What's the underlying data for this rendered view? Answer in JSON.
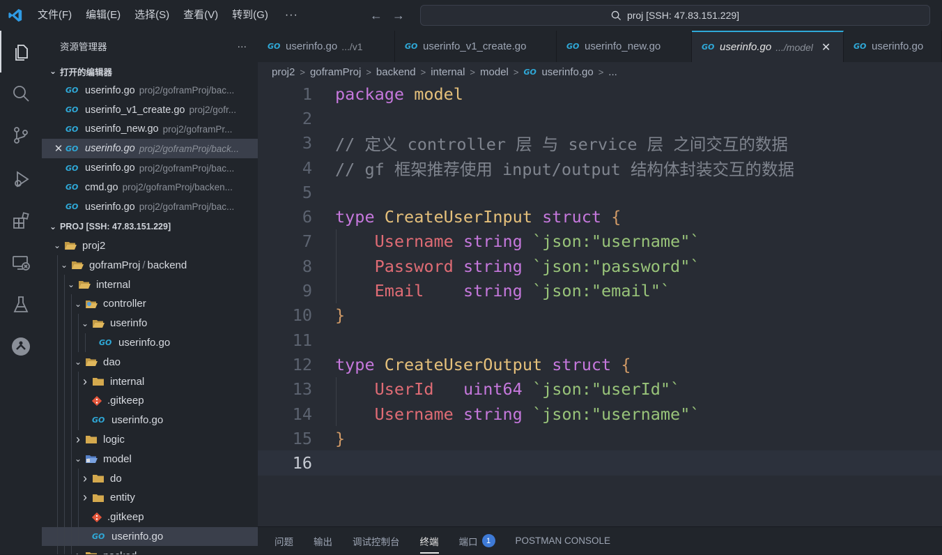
{
  "menu": [
    "文件(F)",
    "编辑(E)",
    "选择(S)",
    "查看(V)",
    "转到(G)"
  ],
  "menu_more": "···",
  "search": {
    "text": "proj [SSH: 47.83.151.229]"
  },
  "explorer": {
    "title": "资源管理器",
    "more": "···",
    "open_editors_title": "打开的编辑器",
    "open_editors": [
      {
        "name": "userinfo.go",
        "path": "proj2/goframProj/bac..."
      },
      {
        "name": "userinfo_v1_create.go",
        "path": "proj2/gofr..."
      },
      {
        "name": "userinfo_new.go",
        "path": "proj2/goframPr..."
      },
      {
        "name": "userinfo.go",
        "path": "proj2/goframProj/back..."
      },
      {
        "name": "userinfo.go",
        "path": "proj2/goframProj/bac..."
      },
      {
        "name": "cmd.go",
        "path": "proj2/goframProj/backen..."
      },
      {
        "name": "userinfo.go",
        "path": "proj2/goframProj/bac..."
      }
    ],
    "workspace_title": "PROJ [SSH: 47.83.151.229]",
    "tree": [
      {
        "label": "proj2"
      },
      {
        "label": "goframProj",
        "label2": "backend",
        "sep": "/"
      },
      {
        "label": "internal"
      },
      {
        "label": "controller"
      },
      {
        "label": "userinfo"
      },
      {
        "label": "userinfo.go"
      },
      {
        "label": "dao"
      },
      {
        "label": "internal"
      },
      {
        "label": ".gitkeep"
      },
      {
        "label": "userinfo.go"
      },
      {
        "label": "logic"
      },
      {
        "label": "model"
      },
      {
        "label": "do"
      },
      {
        "label": "entity"
      },
      {
        "label": ".gitkeep"
      },
      {
        "label": "userinfo.go"
      },
      {
        "label": "packed"
      }
    ]
  },
  "tabs": [
    {
      "name": "userinfo.go",
      "sub": ".../v1"
    },
    {
      "name": "userinfo_v1_create.go",
      "sub": ""
    },
    {
      "name": "userinfo_new.go",
      "sub": ""
    },
    {
      "name": "userinfo.go",
      "sub": ".../model"
    },
    {
      "name": "userinfo.go",
      "sub": ""
    }
  ],
  "tab_close": "✕",
  "go_icon": "GO",
  "breadcrumb": [
    "proj2",
    "goframProj",
    "backend",
    "internal",
    "model",
    "userinfo.go",
    "..."
  ],
  "code": {
    "line_numbers": [
      "1",
      "2",
      "3",
      "4",
      "5",
      "6",
      "7",
      "8",
      "9",
      "10",
      "11",
      "12",
      "13",
      "14",
      "15",
      "16"
    ],
    "l1": [
      "package",
      "model"
    ],
    "l3": "// 定义 controller 层 与 service 层 之间交互的数据",
    "l4": "// gf 框架推荐使用 input/output 结构体封装交互的数据",
    "l6": [
      "type",
      "CreateUserInput",
      "struct",
      "{"
    ],
    "l7": [
      "Username",
      "string",
      "`json:\"username\"`"
    ],
    "l8": [
      "Password",
      "string",
      "`json:\"password\"`"
    ],
    "l9": [
      "Email",
      "string",
      "`json:\"email\"`"
    ],
    "l10": "}",
    "l12": [
      "type",
      "CreateUserOutput",
      "struct",
      "{"
    ],
    "l13": [
      "UserId",
      "uint64",
      "`json:\"userId\"`"
    ],
    "l14": [
      "Username",
      "string",
      "`json:\"username\"`"
    ],
    "l15": "}"
  },
  "panel": {
    "tabs": [
      "问题",
      "输出",
      "调试控制台",
      "终端",
      "端口"
    ],
    "ports_badge": "1",
    "postman": "POSTMAN CONSOLE"
  }
}
